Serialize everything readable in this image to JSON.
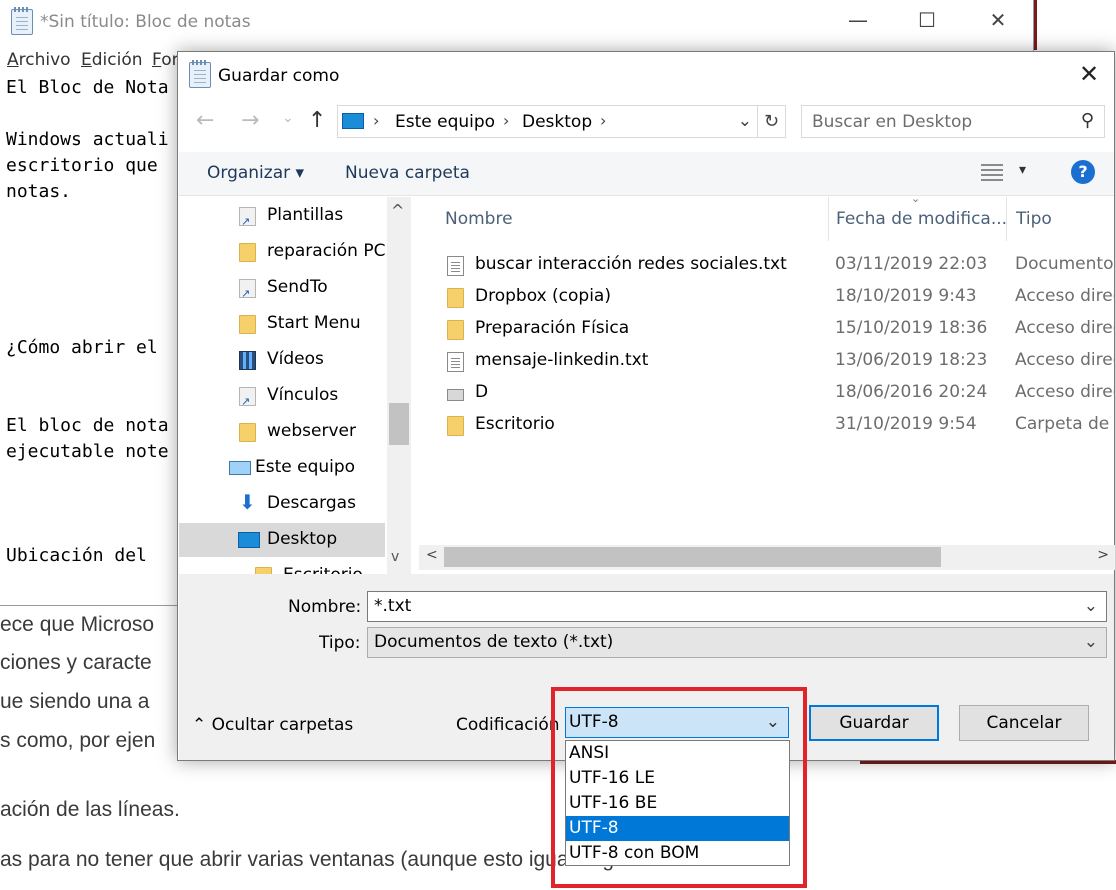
{
  "background_article": {
    "lines": [
      "ece que Microso",
      "ciones y caracte",
      "ue siendo una a",
      "s como, por ejen",
      "ación de las líneas.",
      "as para no tener que abrir varias ventanas (aunque esto igual haga ser"
    ]
  },
  "notepad": {
    "title": "*Sin título: Bloc de notas",
    "window_controls": {
      "minimize": "—",
      "maximize": "☐",
      "close": "✕"
    },
    "menu": [
      "Archivo",
      "Edición",
      "For"
    ],
    "content_lines": [
      "El Bloc de Nota",
      "Windows actuali",
      "escritorio que",
      "notas.",
      "¿Cómo abrir el",
      "El bloc de nota",
      "ejecutable note",
      "Ubicación del "
    ]
  },
  "dialog": {
    "title": "Guardar como",
    "close_icon": "✕",
    "nav": {
      "back": "←",
      "forward": "→",
      "recent": "⌄",
      "up": "↑"
    },
    "address": {
      "segments": [
        "Este equipo",
        "Desktop"
      ],
      "separator": "›",
      "dropdown": "⌄",
      "refresh": "↻"
    },
    "search": {
      "placeholder": "Buscar en Desktop",
      "icon": "⚲"
    },
    "toolbar": {
      "organize": "Organizar ▾",
      "new_folder": "Nueva carpeta",
      "view_dd": "▾",
      "help": "?"
    },
    "sidebar": {
      "items": [
        {
          "label": "Plantillas",
          "icon": "shortcut"
        },
        {
          "label": "reparación PC M",
          "icon": "folder"
        },
        {
          "label": "SendTo",
          "icon": "shortcut"
        },
        {
          "label": "Start Menu",
          "icon": "folder"
        },
        {
          "label": "Vídeos",
          "icon": "film"
        },
        {
          "label": "Vínculos",
          "icon": "shortcut"
        },
        {
          "label": "webserver",
          "icon": "folder"
        },
        {
          "label": "Este equipo",
          "icon": "pc"
        },
        {
          "label": "Descargas",
          "icon": "download"
        },
        {
          "label": "Desktop",
          "icon": "desktop",
          "selected": true
        },
        {
          "label": "Escritorio",
          "icon": "folder"
        }
      ],
      "scroll_up": "^",
      "scroll_down": "v"
    },
    "columns": {
      "name": "Nombre",
      "date": "Fecha de modifica...",
      "type": "Tipo",
      "sort_chevron": "⌄"
    },
    "files": [
      {
        "name": "buscar interacción redes sociales.txt",
        "date": "03/11/2019 22:03",
        "type": "Documento de",
        "icon": "txt"
      },
      {
        "name": "Dropbox (copia)",
        "date": "18/10/2019 9:43",
        "type": "Acceso directo",
        "icon": "shortcut-folder"
      },
      {
        "name": "Preparación Física",
        "date": "15/10/2019 18:36",
        "type": "Acceso directo",
        "icon": "shortcut-folder"
      },
      {
        "name": "mensaje-linkedin.txt",
        "date": "13/06/2019 18:23",
        "type": "Acceso directo",
        "icon": "txt"
      },
      {
        "name": "D",
        "date": "18/06/2016 20:24",
        "type": "Acceso directo",
        "icon": "drive"
      },
      {
        "name": "Escritorio",
        "date": "31/10/2019 9:54",
        "type": "Carpeta de a",
        "icon": "folder"
      }
    ],
    "hscroll": {
      "left": "<",
      "right": ">"
    },
    "filename": {
      "label": "Nombre:",
      "value": "*.txt",
      "dd": "⌄"
    },
    "filetype": {
      "label": "Tipo:",
      "value": "Documentos de texto (*.txt)",
      "dd": "⌄"
    },
    "hide_folders": "⌃  Ocultar carpetas",
    "encoding": {
      "label": "Codificación",
      "value": "UTF-8",
      "dd": "⌄",
      "options": [
        "ANSI",
        "UTF-16 LE",
        "UTF-16 BE",
        "UTF-8",
        "UTF-8 con BOM"
      ],
      "selected_index": 3
    },
    "save": "Guardar",
    "cancel": "Cancelar"
  },
  "colors": {
    "accent": "#0078d7",
    "highlight_box": "#e0242c"
  }
}
